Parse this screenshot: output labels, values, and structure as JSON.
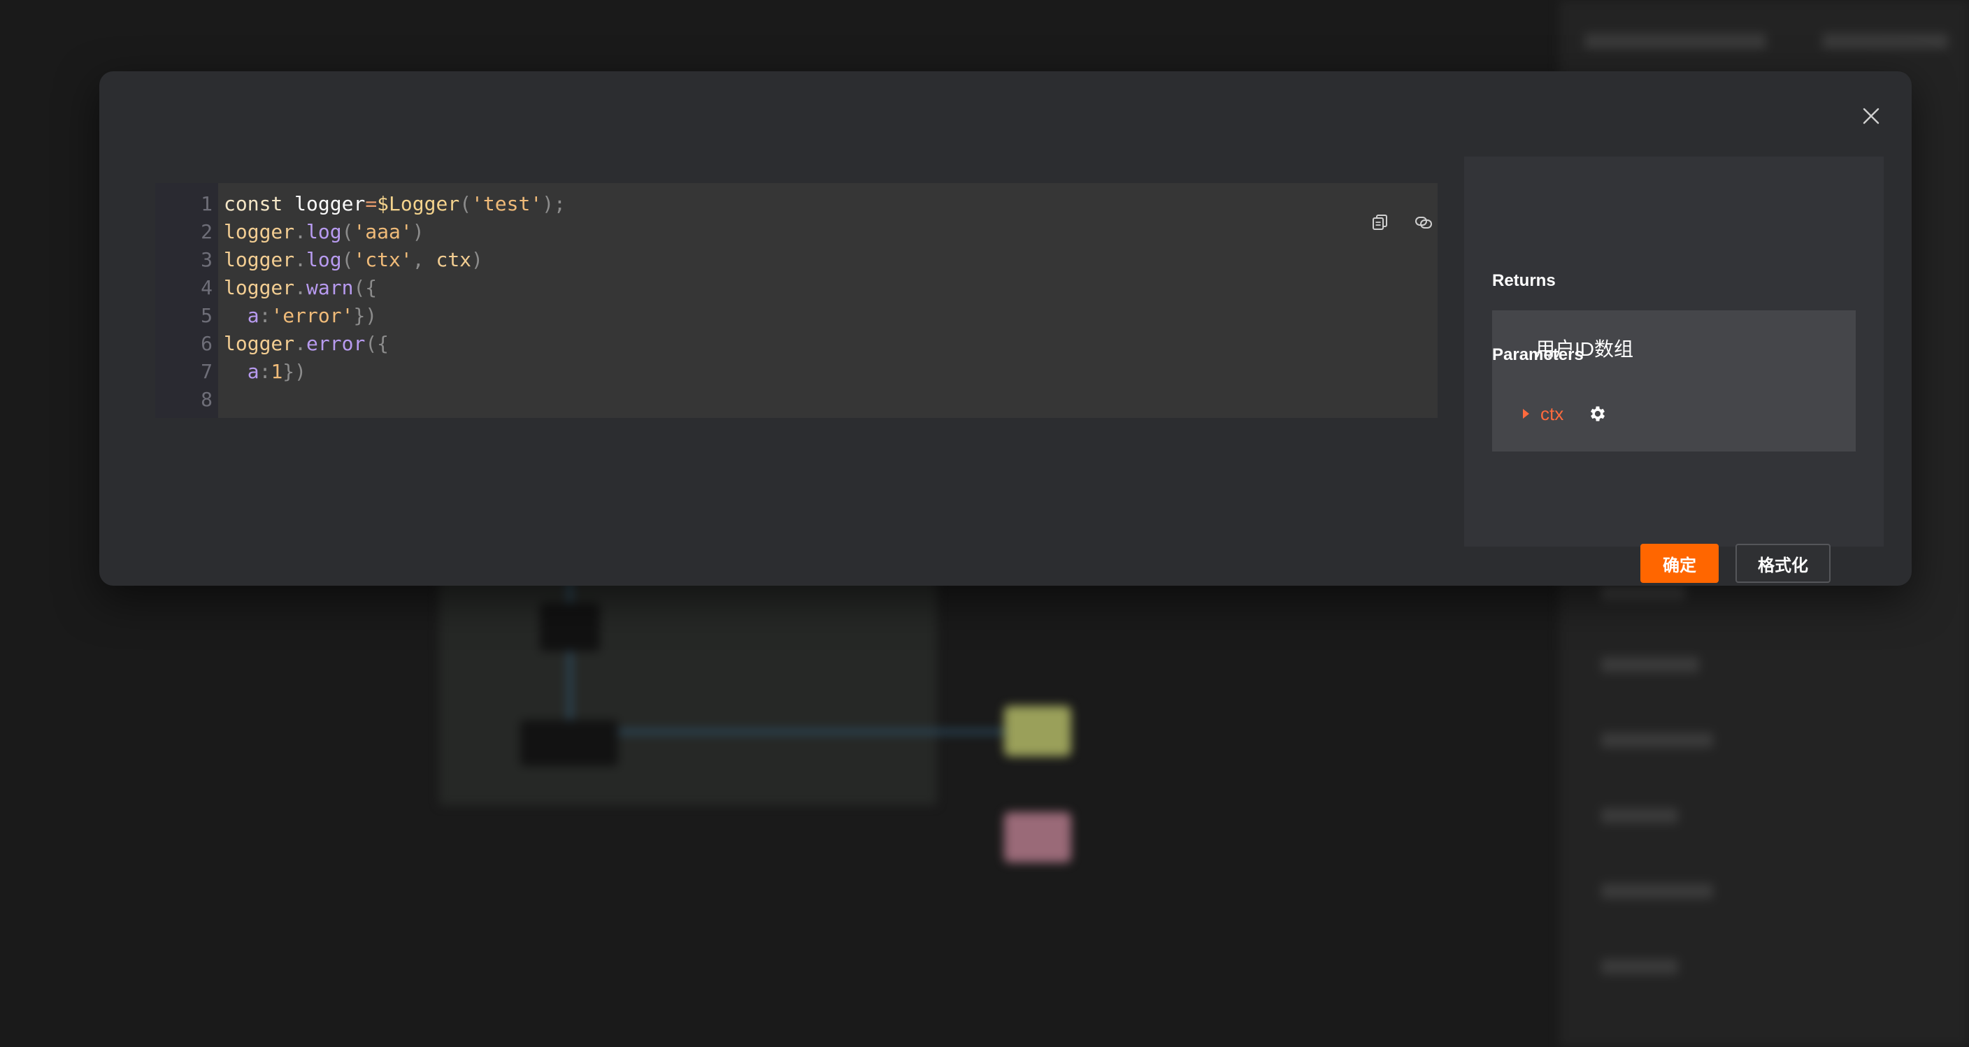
{
  "editor": {
    "line_numbers": [
      "1",
      "2",
      "3",
      "4",
      "5",
      "6",
      "7",
      "8"
    ],
    "lines": [
      [
        {
          "t": "const ",
          "c": "kw"
        },
        {
          "t": "logger",
          "c": "var"
        },
        {
          "t": "=",
          "c": "op"
        },
        {
          "t": "$Logger",
          "c": "fn"
        },
        {
          "t": "(",
          "c": "punc"
        },
        {
          "t": "'test'",
          "c": "str"
        },
        {
          "t": ");",
          "c": "punc"
        }
      ],
      [
        {
          "t": "logger",
          "c": "ident"
        },
        {
          "t": ".",
          "c": "punc"
        },
        {
          "t": "log",
          "c": "method"
        },
        {
          "t": "(",
          "c": "punc"
        },
        {
          "t": "'aaa'",
          "c": "str"
        },
        {
          "t": ")",
          "c": "punc"
        }
      ],
      [
        {
          "t": "logger",
          "c": "ident"
        },
        {
          "t": ".",
          "c": "punc"
        },
        {
          "t": "log",
          "c": "method"
        },
        {
          "t": "(",
          "c": "punc"
        },
        {
          "t": "'ctx'",
          "c": "str"
        },
        {
          "t": ", ",
          "c": "punc"
        },
        {
          "t": "ctx",
          "c": "ident"
        },
        {
          "t": ")",
          "c": "punc"
        }
      ],
      [
        {
          "t": "logger",
          "c": "ident"
        },
        {
          "t": ".",
          "c": "punc"
        },
        {
          "t": "warn",
          "c": "method"
        },
        {
          "t": "({",
          "c": "punc"
        }
      ],
      [
        {
          "t": "  ",
          "c": "punc"
        },
        {
          "t": "a",
          "c": "key"
        },
        {
          "t": ":",
          "c": "punc"
        },
        {
          "t": "'error'",
          "c": "str"
        },
        {
          "t": "})",
          "c": "punc"
        }
      ],
      [
        {
          "t": "logger",
          "c": "ident"
        },
        {
          "t": ".",
          "c": "punc"
        },
        {
          "t": "error",
          "c": "method"
        },
        {
          "t": "({",
          "c": "punc"
        }
      ],
      [
        {
          "t": "  ",
          "c": "punc"
        },
        {
          "t": "a",
          "c": "key"
        },
        {
          "t": ":",
          "c": "punc"
        },
        {
          "t": "1",
          "c": "num"
        },
        {
          "t": "})",
          "c": "punc"
        }
      ],
      []
    ],
    "tools": {
      "copy_icon": "copy-icon",
      "link_icon": "link-icon"
    }
  },
  "panel": {
    "returns_label": "Returns",
    "returns_value": "用户ID数组",
    "parameters_label": "Parameters",
    "parameters": [
      {
        "name": "ctx",
        "icon": "gear-icon"
      }
    ],
    "confirm_label": "确定",
    "format_label": "格式化"
  },
  "colors": {
    "accent": "#ff6600",
    "param_name": "#ff6a3d",
    "modal_bg": "#2c2d30",
    "panel_bg": "#333438"
  }
}
